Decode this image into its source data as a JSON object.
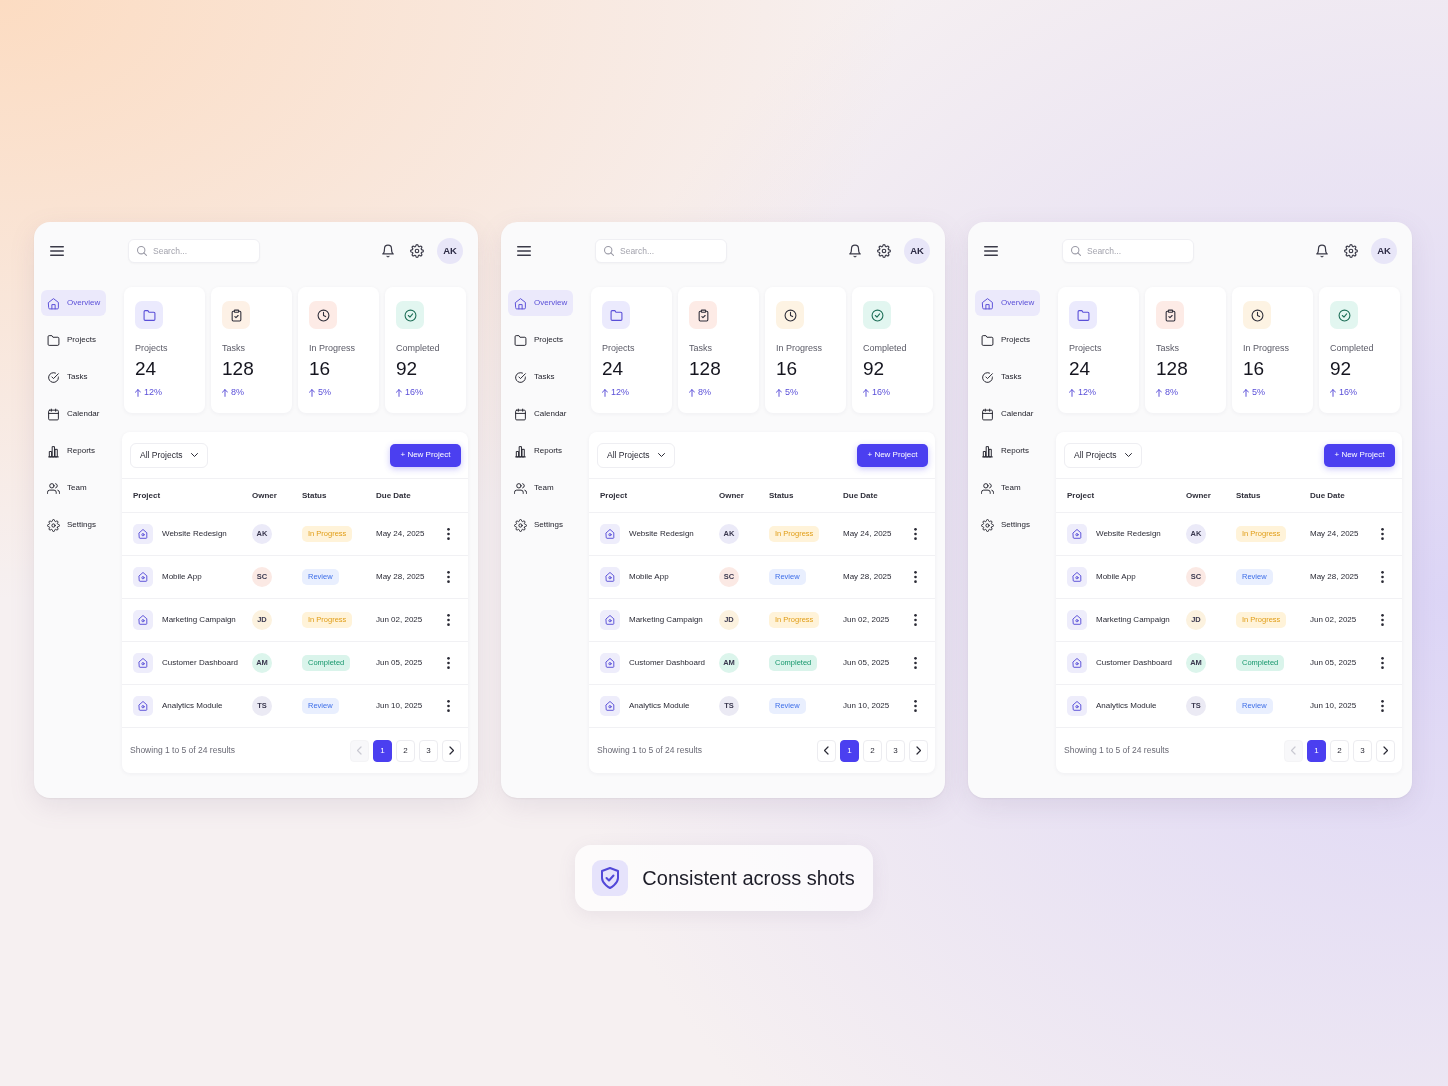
{
  "panels": [
    {
      "search": {
        "placeholder": "Search..."
      },
      "user": {
        "initials": "AK"
      },
      "nav": [
        {
          "kind": "overview",
          "label": "Overview",
          "selected": true
        },
        {
          "kind": "projects",
          "label": "Projects",
          "selected": false
        },
        {
          "kind": "tasks",
          "label": "Tasks",
          "selected": false
        },
        {
          "kind": "calendar",
          "label": "Calendar",
          "selected": false
        },
        {
          "kind": "reports",
          "label": "Reports",
          "selected": false
        },
        {
          "kind": "team",
          "label": "Team",
          "selected": false
        },
        {
          "kind": "settings",
          "label": "Settings",
          "selected": false
        }
      ],
      "stats": [
        {
          "kind": "projects",
          "color": "#ebeafd",
          "label": "Projects",
          "value": "24",
          "change": "12%"
        },
        {
          "kind": "tasks",
          "color": "#fdf1e6",
          "label": "Tasks",
          "value": "128",
          "change": "8%"
        },
        {
          "kind": "in_progress",
          "color": "#fdebe6",
          "label": "In Progress",
          "value": "16",
          "change": "5%"
        },
        {
          "kind": "completed",
          "color": "#e2f6f0",
          "label": "Completed",
          "value": "92",
          "change": "16%"
        }
      ],
      "filter": {
        "value": "All Projects"
      },
      "new_button": {
        "label": "+ New Project"
      },
      "table": {
        "columns": [
          "Project",
          "Owner",
          "Status",
          "Due Date"
        ],
        "rows": [
          {
            "project": "Website Redesign",
            "owner": {
              "initials": "AK",
              "color": "#ebeaf8"
            },
            "status": {
              "kind": "in_progress",
              "label": "In Progress"
            },
            "due": "May 24, 2025"
          },
          {
            "project": "Mobile App",
            "owner": {
              "initials": "SC",
              "color": "#fbe9e4"
            },
            "status": {
              "kind": "review",
              "label": "Review"
            },
            "due": "May 28, 2025"
          },
          {
            "project": "Marketing Campaign",
            "owner": {
              "initials": "JD",
              "color": "#fcf2df"
            },
            "status": {
              "kind": "in_progress",
              "label": "In Progress"
            },
            "due": "Jun 02, 2025"
          },
          {
            "project": "Customer Dashboard",
            "owner": {
              "initials": "AM",
              "color": "#dcf5ec"
            },
            "status": {
              "kind": "completed",
              "label": "Completed"
            },
            "due": "Jun 05, 2025"
          },
          {
            "project": "Analytics Module",
            "owner": {
              "initials": "TS",
              "color": "#ebeaf4"
            },
            "status": {
              "kind": "review",
              "label": "Review"
            },
            "due": "Jun 10, 2025"
          }
        ]
      },
      "footer": {
        "summary": "Showing 1 to 5 of 24 results",
        "previous": {
          "disabled": true
        },
        "pages": [
          {
            "label": "1",
            "selected": true
          },
          {
            "label": "2",
            "selected": false
          },
          {
            "label": "3",
            "selected": false
          }
        ],
        "next": {
          "disabled": false
        }
      }
    },
    {
      "search": {
        "placeholder": "Search..."
      },
      "user": {
        "initials": "AK"
      },
      "nav": [
        {
          "kind": "overview",
          "label": "Overview",
          "selected": true
        },
        {
          "kind": "projects",
          "label": "Projects",
          "selected": false
        },
        {
          "kind": "tasks",
          "label": "Tasks",
          "selected": false
        },
        {
          "kind": "calendar",
          "label": "Calendar",
          "selected": false
        },
        {
          "kind": "reports",
          "label": "Reports",
          "selected": false
        },
        {
          "kind": "team",
          "label": "Team",
          "selected": false
        },
        {
          "kind": "settings",
          "label": "Settings",
          "selected": false
        }
      ],
      "stats": [
        {
          "kind": "projects",
          "color": "#ebeafd",
          "label": "Projects",
          "value": "24",
          "change": "12%"
        },
        {
          "kind": "tasks",
          "color": "#fdebe6",
          "label": "Tasks",
          "value": "128",
          "change": "8%"
        },
        {
          "kind": "in_progress",
          "color": "#fdf3e3",
          "label": "In Progress",
          "value": "16",
          "change": "5%"
        },
        {
          "kind": "completed",
          "color": "#e2f6f0",
          "label": "Completed",
          "value": "92",
          "change": "16%"
        }
      ],
      "filter": {
        "value": "All Projects"
      },
      "new_button": {
        "label": "+ New Project"
      },
      "table": {
        "columns": [
          "Project",
          "Owner",
          "Status",
          "Due Date"
        ],
        "rows": [
          {
            "project": "Website Redesign",
            "owner": {
              "initials": "AK",
              "color": "#ebeaf8"
            },
            "status": {
              "kind": "in_progress",
              "label": "In Progress"
            },
            "due": "May 24, 2025"
          },
          {
            "project": "Mobile App",
            "owner": {
              "initials": "SC",
              "color": "#fbe9e4"
            },
            "status": {
              "kind": "review",
              "label": "Review"
            },
            "due": "May 28, 2025"
          },
          {
            "project": "Marketing Campaign",
            "owner": {
              "initials": "JD",
              "color": "#fcf2df"
            },
            "status": {
              "kind": "in_progress",
              "label": "In Progress"
            },
            "due": "Jun 02, 2025"
          },
          {
            "project": "Customer Dashboard",
            "owner": {
              "initials": "AM",
              "color": "#dcf5ec"
            },
            "status": {
              "kind": "completed",
              "label": "Completed"
            },
            "due": "Jun 05, 2025"
          },
          {
            "project": "Analytics Module",
            "owner": {
              "initials": "TS",
              "color": "#ebeaf4"
            },
            "status": {
              "kind": "review",
              "label": "Review"
            },
            "due": "Jun 10, 2025"
          }
        ]
      },
      "footer": {
        "summary": "Showing 1 to 5 of 24 results",
        "previous": {
          "disabled": false
        },
        "pages": [
          {
            "label": "1",
            "selected": true
          },
          {
            "label": "2",
            "selected": false
          },
          {
            "label": "3",
            "selected": false
          }
        ],
        "next": {
          "disabled": false
        }
      }
    },
    {
      "search": {
        "placeholder": "Search..."
      },
      "user": {
        "initials": "AK"
      },
      "nav": [
        {
          "kind": "overview",
          "label": "Overview",
          "selected": true
        },
        {
          "kind": "projects",
          "label": "Projects",
          "selected": false
        },
        {
          "kind": "tasks",
          "label": "Tasks",
          "selected": false
        },
        {
          "kind": "calendar",
          "label": "Calendar",
          "selected": false
        },
        {
          "kind": "reports",
          "label": "Reports",
          "selected": false
        },
        {
          "kind": "team",
          "label": "Team",
          "selected": false
        },
        {
          "kind": "settings",
          "label": "Settings",
          "selected": false
        }
      ],
      "stats": [
        {
          "kind": "projects",
          "color": "#ebeafd",
          "label": "Projects",
          "value": "24",
          "change": "12%"
        },
        {
          "kind": "tasks",
          "color": "#fdebe6",
          "label": "Tasks",
          "value": "128",
          "change": "8%"
        },
        {
          "kind": "in_progress",
          "color": "#fdf3e3",
          "label": "In Progress",
          "value": "16",
          "change": "5%"
        },
        {
          "kind": "completed",
          "color": "#e2f6f0",
          "label": "Completed",
          "value": "92",
          "change": "16%"
        }
      ],
      "filter": {
        "value": "All Projects"
      },
      "new_button": {
        "label": "+ New Project"
      },
      "table": {
        "columns": [
          "Project",
          "Owner",
          "Status",
          "Due Date"
        ],
        "rows": [
          {
            "project": "Website Redesign",
            "owner": {
              "initials": "AK",
              "color": "#ebeaf8"
            },
            "status": {
              "kind": "in_progress",
              "label": "In Progress"
            },
            "due": "May 24, 2025"
          },
          {
            "project": "Mobile App",
            "owner": {
              "initials": "SC",
              "color": "#fbe9e4"
            },
            "status": {
              "kind": "review",
              "label": "Review"
            },
            "due": "May 28, 2025"
          },
          {
            "project": "Marketing Campaign",
            "owner": {
              "initials": "JD",
              "color": "#fcf2df"
            },
            "status": {
              "kind": "in_progress",
              "label": "In Progress"
            },
            "due": "Jun 02, 2025"
          },
          {
            "project": "Customer Dashboard",
            "owner": {
              "initials": "AM",
              "color": "#dcf5ec"
            },
            "status": {
              "kind": "completed",
              "label": "Completed"
            },
            "due": "Jun 05, 2025"
          },
          {
            "project": "Analytics Module",
            "owner": {
              "initials": "TS",
              "color": "#ebeaf4"
            },
            "status": {
              "kind": "review",
              "label": "Review"
            },
            "due": "Jun 10, 2025"
          }
        ]
      },
      "footer": {
        "summary": "Showing 1 to 5 of 24 results",
        "previous": {
          "disabled": true
        },
        "pages": [
          {
            "label": "1",
            "selected": true
          },
          {
            "label": "2",
            "selected": false
          },
          {
            "label": "3",
            "selected": false
          }
        ],
        "next": {
          "disabled": false
        }
      }
    }
  ],
  "caption": {
    "text": "Consistent across shots"
  }
}
